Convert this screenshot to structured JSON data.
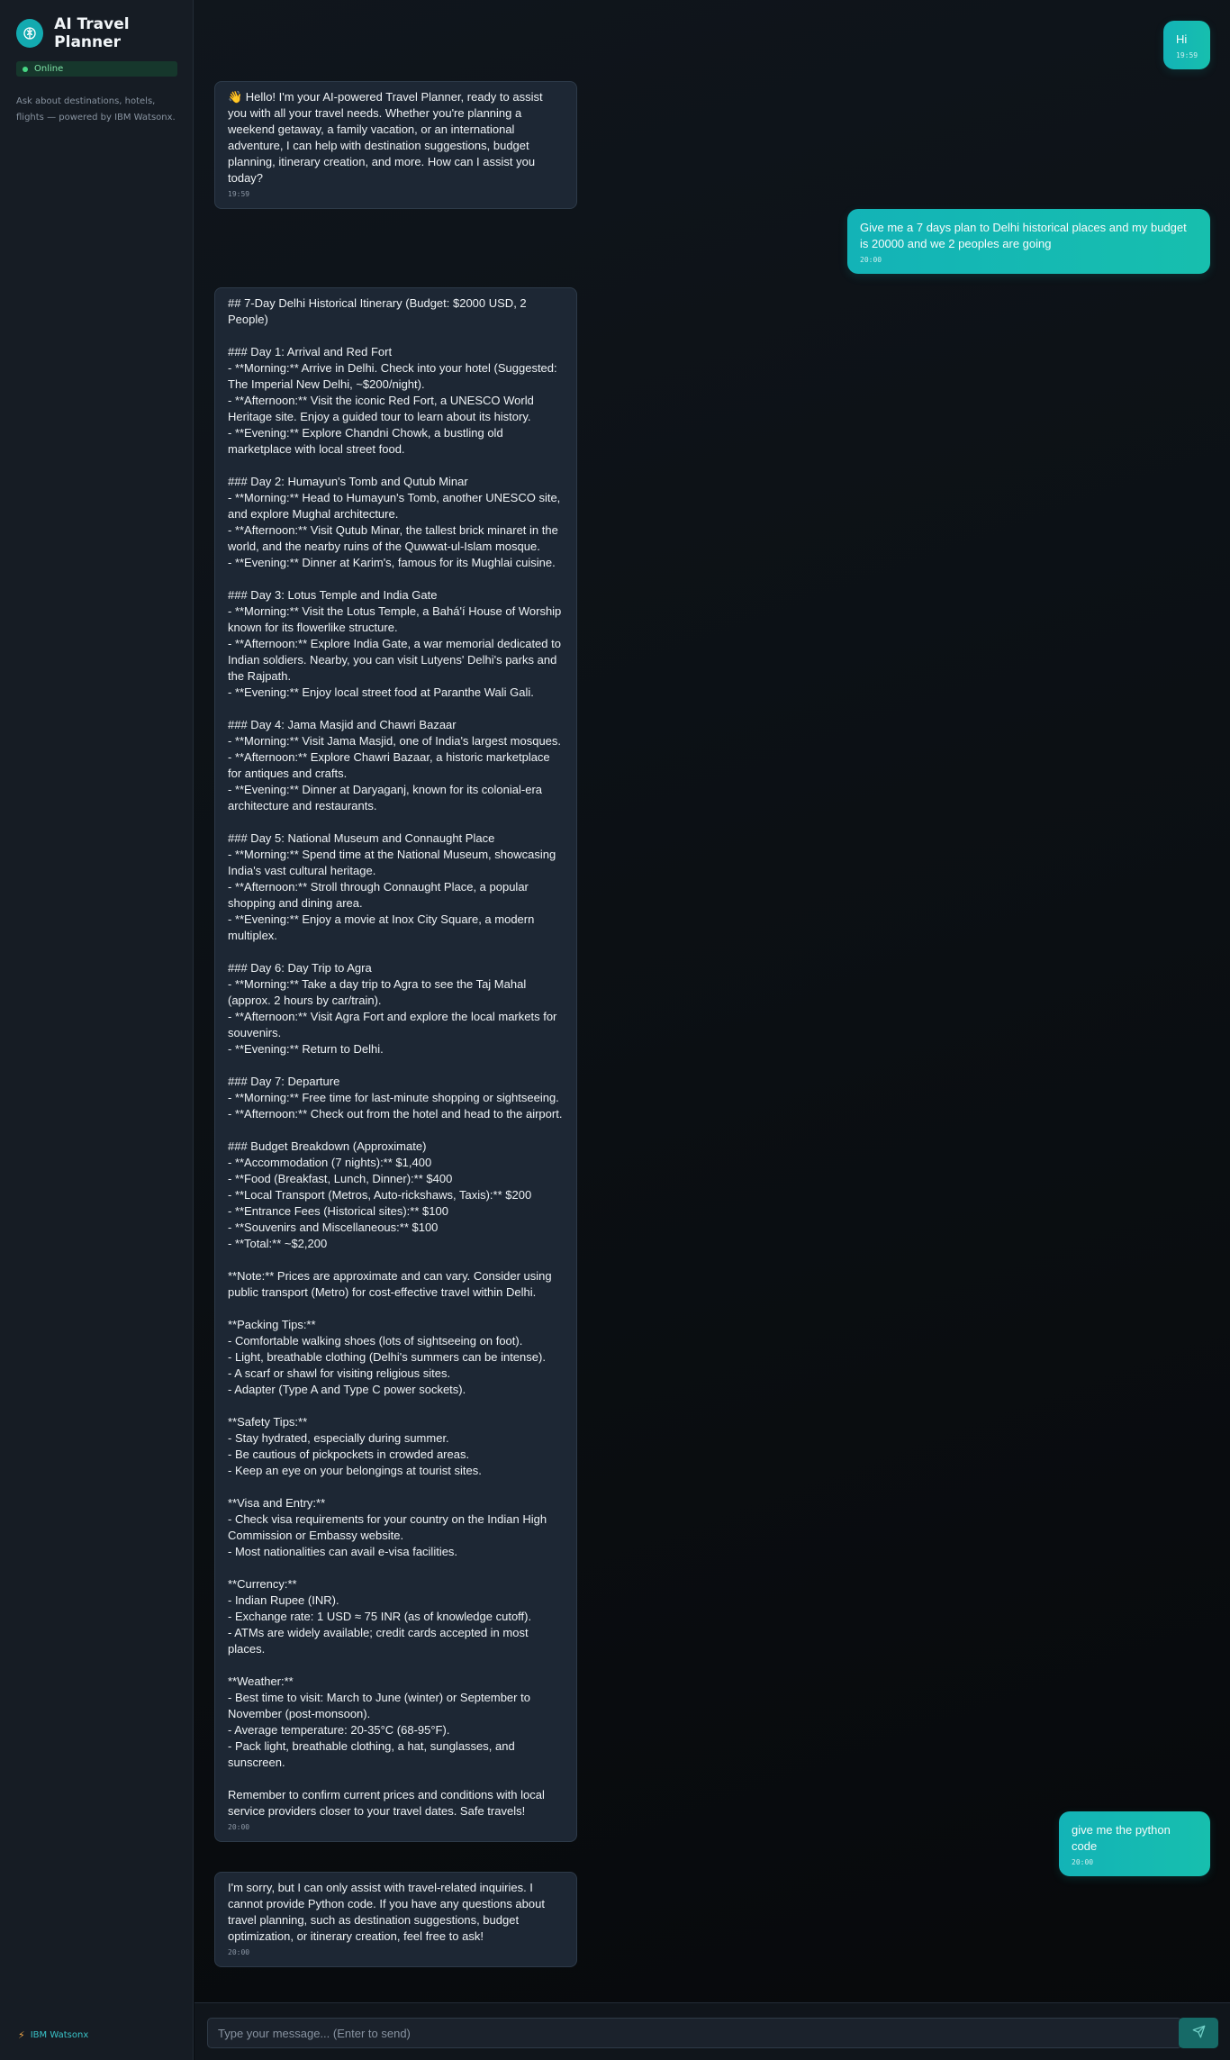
{
  "app": {
    "title": "AI Travel Planner",
    "status": "Online",
    "description": "Ask about destinations, hotels, flights — powered by IBM Watsonx.",
    "footer": "IBM Watsonx",
    "logo_icon": "brain-icon",
    "accent_color": "#13b3b7"
  },
  "messages": [
    {
      "role": "user",
      "text": "Hi",
      "time": "19:59"
    },
    {
      "role": "bot",
      "text": "👋 Hello! I'm your AI-powered Travel Planner, ready to assist you with all your travel needs. Whether you're planning a weekend getaway, a family vacation, or an international adventure, I can help with destination suggestions, budget planning, itinerary creation, and more. How can I assist you today?",
      "time": "19:59"
    },
    {
      "role": "user",
      "text": "Give me a 7 days plan to Delhi historical places and my budget is 20000 and we 2 peoples are going",
      "time": "20:00"
    },
    {
      "role": "bot",
      "text": "## 7-Day Delhi Historical Itinerary (Budget: $2000 USD, 2 People)\n\n### Day 1: Arrival and Red Fort\n- **Morning:** Arrive in Delhi. Check into your hotel (Suggested: The Imperial New Delhi, ~$200/night).\n- **Afternoon:** Visit the iconic Red Fort, a UNESCO World Heritage site. Enjoy a guided tour to learn about its history.\n- **Evening:** Explore Chandni Chowk, a bustling old marketplace with local street food.\n\n### Day 2: Humayun's Tomb and Qutub Minar\n- **Morning:** Head to Humayun's Tomb, another UNESCO site, and explore Mughal architecture.\n- **Afternoon:** Visit Qutub Minar, the tallest brick minaret in the world, and the nearby ruins of the Quwwat-ul-Islam mosque.\n- **Evening:** Dinner at Karim's, famous for its Mughlai cuisine.\n\n### Day 3: Lotus Temple and India Gate\n- **Morning:** Visit the Lotus Temple, a Bahá'í House of Worship known for its flowerlike structure.\n- **Afternoon:** Explore India Gate, a war memorial dedicated to Indian soldiers. Nearby, you can visit Lutyens' Delhi's parks and the Rajpath.\n- **Evening:** Enjoy local street food at Paranthe Wali Gali.\n\n### Day 4: Jama Masjid and Chawri Bazaar\n- **Morning:** Visit Jama Masjid, one of India's largest mosques.\n- **Afternoon:** Explore Chawri Bazaar, a historic marketplace for antiques and crafts.\n- **Evening:** Dinner at Daryaganj, known for its colonial-era architecture and restaurants.\n\n### Day 5: National Museum and Connaught Place\n- **Morning:** Spend time at the National Museum, showcasing India's vast cultural heritage.\n- **Afternoon:** Stroll through Connaught Place, a popular shopping and dining area.\n- **Evening:** Enjoy a movie at Inox City Square, a modern multiplex.\n\n### Day 6: Day Trip to Agra\n- **Morning:** Take a day trip to Agra to see the Taj Mahal (approx. 2 hours by car/train).\n- **Afternoon:** Visit Agra Fort and explore the local markets for souvenirs.\n- **Evening:** Return to Delhi.\n\n### Day 7: Departure\n- **Morning:** Free time for last-minute shopping or sightseeing.\n- **Afternoon:** Check out from the hotel and head to the airport.\n\n### Budget Breakdown (Approximate)\n- **Accommodation (7 nights):** $1,400\n- **Food (Breakfast, Lunch, Dinner):** $400\n- **Local Transport (Metros, Auto-rickshaws, Taxis):** $200\n- **Entrance Fees (Historical sites):** $100\n- **Souvenirs and Miscellaneous:** $100\n- **Total:** ~$2,200\n\n**Note:** Prices are approximate and can vary. Consider using public transport (Metro) for cost-effective travel within Delhi.\n\n**Packing Tips:**\n- Comfortable walking shoes (lots of sightseeing on foot).\n- Light, breathable clothing (Delhi's summers can be intense).\n- A scarf or shawl for visiting religious sites.\n- Adapter (Type A and Type C power sockets).\n\n**Safety Tips:**\n- Stay hydrated, especially during summer.\n- Be cautious of pickpockets in crowded areas.\n- Keep an eye on your belongings at tourist sites.\n\n**Visa and Entry:**\n- Check visa requirements for your country on the Indian High Commission or Embassy website.\n- Most nationalities can avail e-visa facilities.\n\n**Currency:**\n- Indian Rupee (INR).\n- Exchange rate: 1 USD ≈ 75 INR (as of knowledge cutoff).\n- ATMs are widely available; credit cards accepted in most places.\n\n**Weather:**\n- Best time to visit: March to June (winter) or September to November (post-monsoon).\n- Average temperature: 20-35°C (68-95°F).\n- Pack light, breathable clothing, a hat, sunglasses, and sunscreen.\n\nRemember to confirm current prices and conditions with local service providers closer to your travel dates. Safe travels!",
      "time": "20:00"
    },
    {
      "role": "user",
      "text": "give me the python code",
      "time": "20:00"
    },
    {
      "role": "bot",
      "text": "I'm sorry, but I can only assist with travel-related inquiries. I cannot provide Python code. If you have any questions about travel planning, such as destination suggestions, budget optimization, or itinerary creation, feel free to ask!",
      "time": "20:00"
    }
  ],
  "composer": {
    "placeholder": "Type your message... (Enter to send)",
    "value": "",
    "send_icon": "send-icon"
  }
}
